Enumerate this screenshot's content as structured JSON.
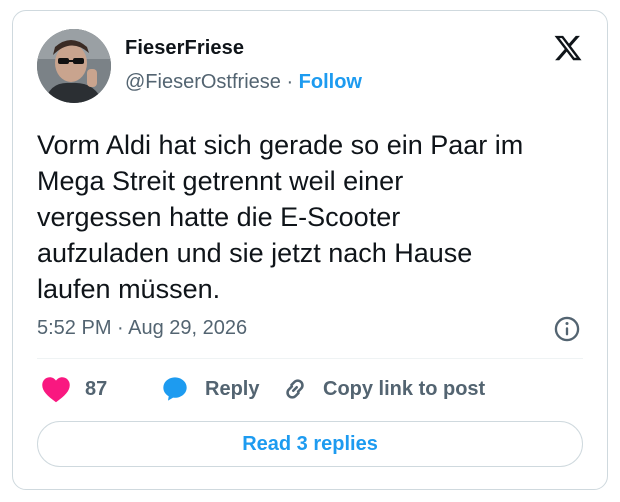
{
  "author": {
    "display_name": "FieserFriese",
    "handle": "@FieserOstfriese",
    "separator": " · ",
    "follow_label": "Follow"
  },
  "tweet": {
    "text_lines": [
      "Vorm Aldi hat sich gerade so ein Paar im",
      "Mega Streit getrennt weil einer",
      "vergessen hatte die E-Scooter",
      "aufzuladen und sie jetzt nach Hause",
      "laufen müssen."
    ],
    "timestamp": "5:52 PM · Aug 29, 2026"
  },
  "actions": {
    "like_count": "87",
    "reply_label": "Reply",
    "copy_label": "Copy link to post"
  },
  "read_replies_label": "Read 3 replies",
  "icons": {
    "logo": "x-logo-icon",
    "like": "heart-icon",
    "reply": "speech-bubble-icon",
    "copy": "link-icon",
    "info": "info-icon"
  },
  "colors": {
    "accent": "#1d9bf0",
    "like": "#f91880",
    "muted_text": "#536471",
    "border": "#cfd9de"
  }
}
